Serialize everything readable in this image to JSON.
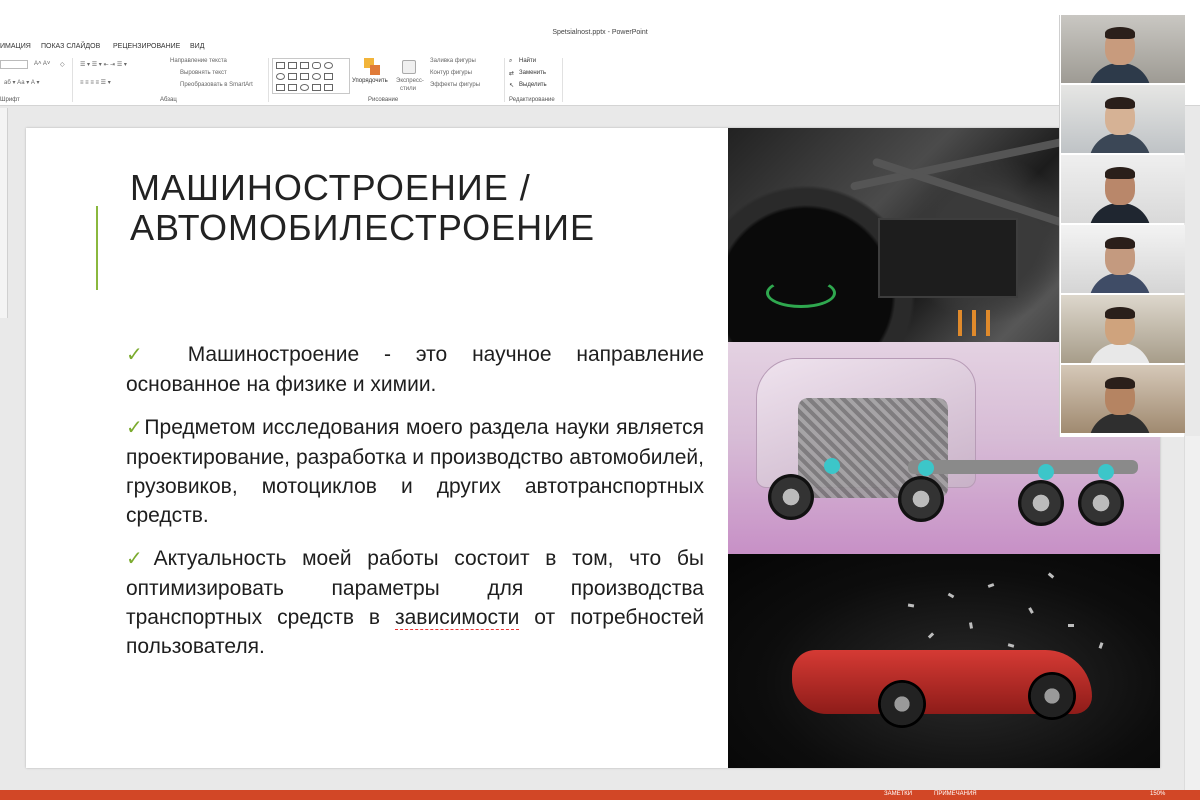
{
  "window": {
    "title": "Spetsialnost.pptx - PowerPoint"
  },
  "ribbon_tabs": [
    "ИМАЦИЯ",
    "ПОКАЗ СЛАЙДОВ",
    "РЕЦЕНЗИРОВАНИЕ",
    "ВИД"
  ],
  "ribbon": {
    "groups": {
      "font": "Шрифт",
      "paragraph": "Абзац",
      "drawing": "Рисование",
      "editing": "Редактирование"
    },
    "paragraph": {
      "text_direction": "Направление текста",
      "align_text": "Выровнять текст",
      "convert_smartart": "Преобразовать в SmartArt"
    },
    "drawing": {
      "arrange": "Упорядочить",
      "quick_styles_1": "Экспресс-",
      "quick_styles_2": "стили",
      "shape_fill": "Заливка фигуры",
      "shape_outline": "Контур фигуры",
      "shape_effects": "Эффекты фигуры"
    },
    "editing": {
      "find": "Найти",
      "replace": "Заменить",
      "select": "Выделить"
    }
  },
  "slide": {
    "title_line1": "МАШИНОСТРОЕНИЕ /",
    "title_line2": "АВТОМОБИЛЕСТРОЕНИЕ",
    "bullets": [
      "Машиностроение - это научное направление основанное на физике и химии.",
      "Предметом исследования моего раздела науки является проектирование, разработка и производство автомобилей, грузовиков, мотоциклов и других автотранспортных средств."
    ],
    "bullet3_part1": "Актуальность моей работы состоит в том, что бы оптимизировать параметры для производства транспортных средств в ",
    "bullet3_misspelled": "зависимости",
    "bullet3_part2": " от потребностей пользователя."
  },
  "status_bar": {
    "notes": "ЗАМЕТКИ",
    "comments": "ПРИМЕЧАНИЯ",
    "zoom": "150%"
  },
  "icons": [
    "checkmark-icon",
    "find-icon",
    "replace-icon",
    "select-icon",
    "arrange-icon",
    "quick-styles-icon"
  ],
  "colors": {
    "accent_green": "#8ab83e",
    "status_bar": "#d24726"
  }
}
